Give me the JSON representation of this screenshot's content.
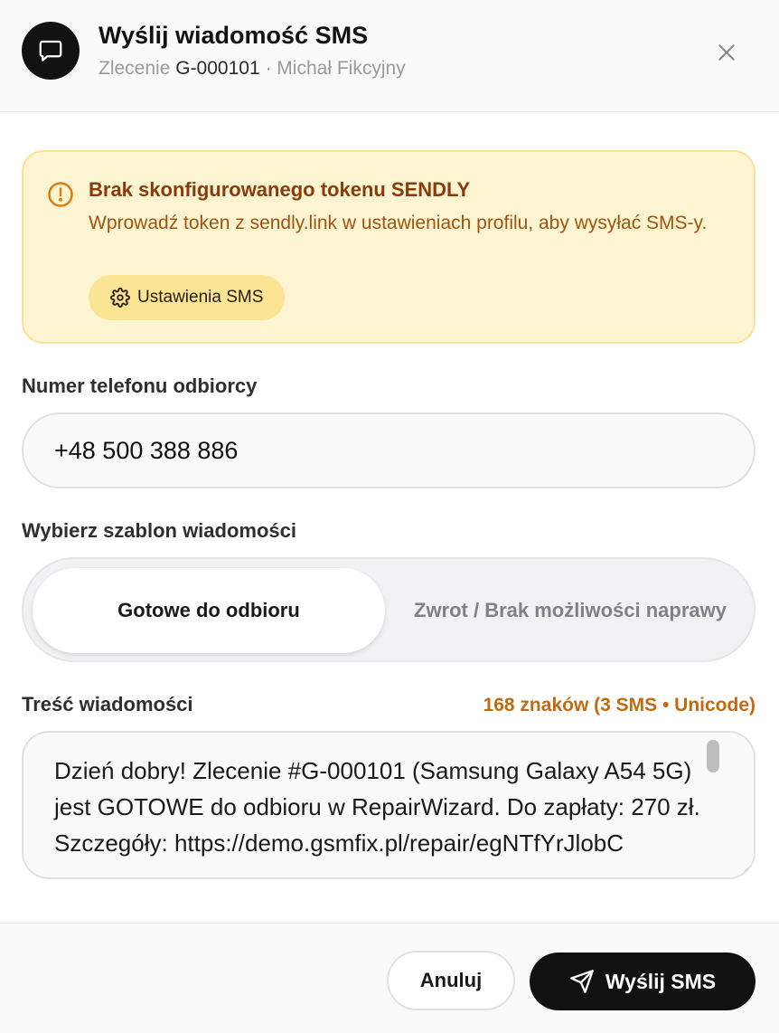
{
  "dialog": {
    "title": "Wyślij wiadomość SMS",
    "subtitle_prefix": "Zlecenie",
    "order_id": "G-000101",
    "subtitle_suffix": "· Michał Fikcyjny"
  },
  "alert": {
    "title": "Brak skonfigurowanego tokenu SENDLY",
    "text": "Wprowadź token z sendly.link w ustawieniach profilu, aby wysyłać SMS-y.",
    "button_label": "Ustawienia SMS"
  },
  "phone": {
    "label": "Numer telefonu odbiorcy",
    "value": "+48 500 388 886"
  },
  "template": {
    "label": "Wybierz szablon wiadomości",
    "options": [
      "Gotowe do odbioru",
      "Zwrot / Brak możliwości naprawy"
    ],
    "selected": "Gotowe do odbioru"
  },
  "message": {
    "label": "Treść wiadomości",
    "counter": "168 znaków (3 SMS • Unicode)",
    "text": "Dzień dobry! Zlecenie #G-000101 (Samsung Galaxy A54 5G) jest GOTOWE do odbioru w RepairWizard. Do zapłaty: 270 zł. Szczegóły: https://demo.gsmfix.pl/repair/egNTfYrJlobC"
  },
  "footer": {
    "cancel_label": "Anuluj",
    "send_label": "Wyślij SMS"
  },
  "icons": {
    "avatar": "message-square-icon",
    "close": "close-icon",
    "alert": "alert-circle-icon",
    "settings": "gear-icon",
    "send": "send-icon"
  },
  "colors": {
    "alert_bg": "#fdf5d2",
    "alert_title": "#8a3b0c",
    "counter": "#c26a12",
    "primary": "#111111"
  }
}
